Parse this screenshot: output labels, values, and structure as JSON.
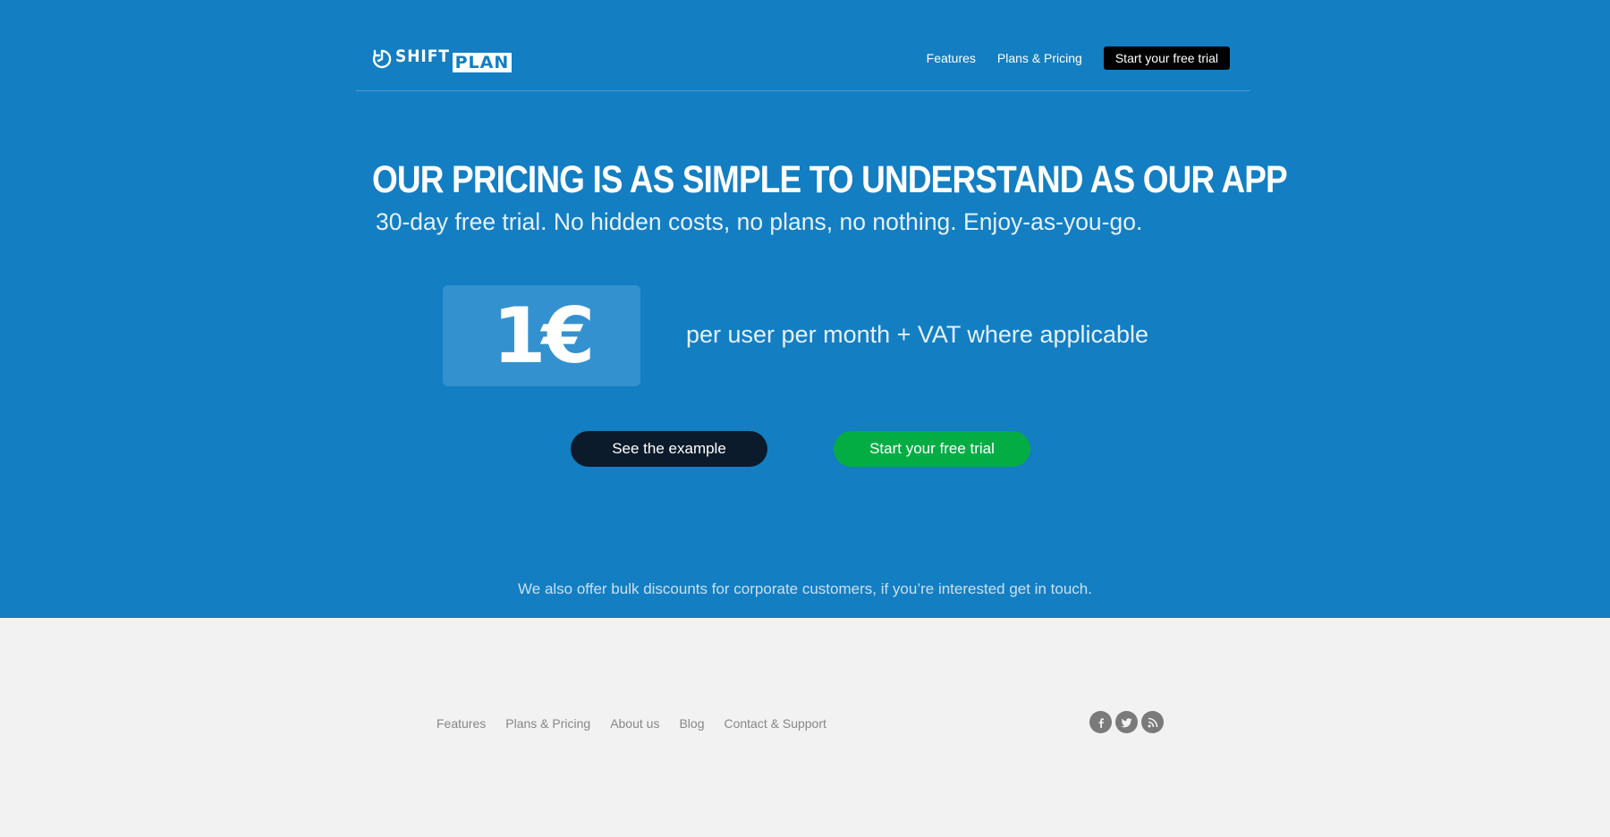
{
  "brand": {
    "logo_part1": "SHIFT",
    "logo_part2": "PLAN",
    "logo_icon": "clock-refresh-icon",
    "color_primary": "#137ec2",
    "color_cta_green": "#04ad44",
    "color_dark": "#0c1b2b"
  },
  "nav": {
    "items": [
      "Features",
      "Plans & Pricing"
    ],
    "cta_label": "Start your free trial"
  },
  "hero": {
    "headline": "OUR PRICING IS AS SIMPLE TO UNDERSTAND AS OUR APP",
    "subheadline": "30-day free trial. No hidden costs, no plans, no nothing. Enjoy-as-you-go.",
    "price": "1€",
    "price_description": "per user per month + VAT where applicable",
    "buttons": {
      "example_label": "See the example",
      "trial_label": "Start your free trial"
    },
    "bulk_note": "We also offer bulk discounts for corporate customers, if you’re interested get in touch."
  },
  "footer": {
    "links": [
      "Features",
      "Plans & Pricing",
      "About us",
      "Blog",
      "Contact & Support"
    ],
    "social": [
      {
        "name": "facebook-icon",
        "glyph": "f"
      },
      {
        "name": "twitter-icon",
        "glyph": "t"
      },
      {
        "name": "rss-icon",
        "glyph": "rss"
      }
    ]
  }
}
